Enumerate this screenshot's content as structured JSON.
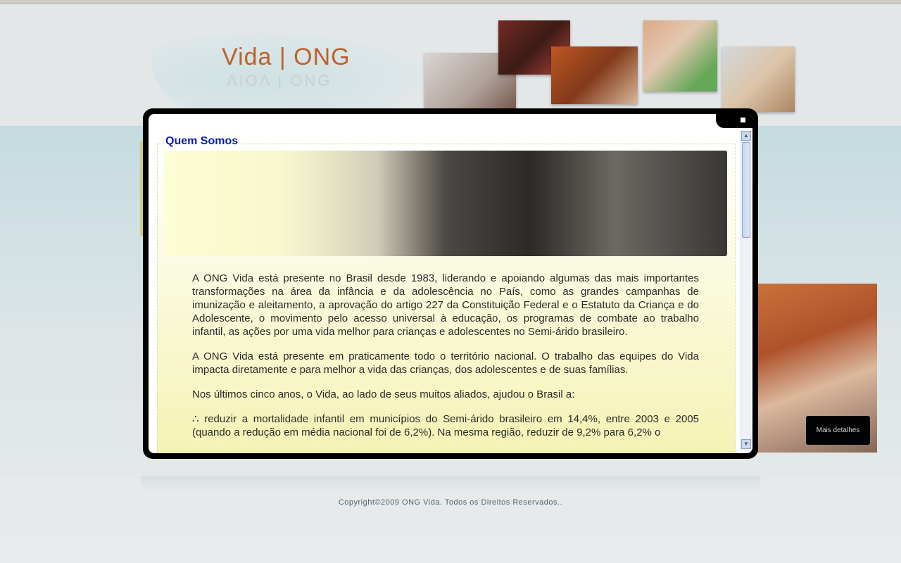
{
  "header": {
    "logo_text": "Vida | ONG"
  },
  "modal": {
    "section_title": "Quem Somos",
    "paragraphs": [
      "A ONG Vida está presente no Brasil desde 1983, liderando e apoiando algumas das mais importantes transformações na área da infância e da adolescência no País, como as grandes campanhas de imunização e aleitamento, a aprovação do artigo 227 da Constituição Federal e o Estatuto da Criança e do Adolescente, o movimento pelo acesso universal à educação, os programas de combate ao trabalho infantil, as ações por uma vida melhor para crianças e adolescentes no Semi-árido brasileiro.",
      "A ONG Vida está presente em praticamente todo o território nacional. O trabalho das equipes do Vida impacta diretamente e para melhor a vida das crianças, dos adolescentes e de suas famílias.",
      "Nos últimos cinco anos, o Vida, ao lado de seus muitos aliados, ajudou o Brasil a:",
      "∴ reduzir a mortalidade infantil em municípios do Semi-árido brasileiro em 14,4%, entre 2003 e 2005 (quando a redução em média nacional foi de 6,2%). Na mesma região, reduzir de 9,2% para 6,2% o"
    ],
    "scroll_up_label": "▲",
    "scroll_down_label": "▼"
  },
  "more_details_button": "Mais detalhes",
  "footer": {
    "copyright": "Copyright©2009 ONG Vida. Todos os Direitos Reservados.."
  },
  "colors": {
    "logo": "#c8642a",
    "section_title": "#0a1aa8",
    "modal_frame": "#000000"
  },
  "icons": {
    "close": "close-icon"
  }
}
